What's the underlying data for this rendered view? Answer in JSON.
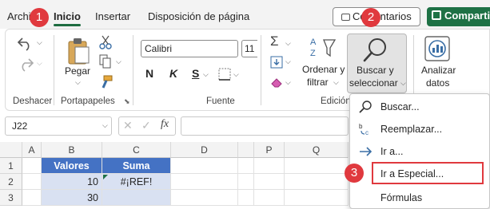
{
  "tabs": [
    {
      "label": "Archivo",
      "active": false
    },
    {
      "label": "Inicio",
      "active": true
    },
    {
      "label": "Insertar",
      "active": false
    },
    {
      "label": "Disposición de página",
      "active": false
    }
  ],
  "header_buttons": {
    "comments": "Comentarios",
    "share": "Compartir"
  },
  "ribbon": {
    "undo_group_label": "Deshacer",
    "clipboard": {
      "paste_label": "Pegar",
      "group_label": "Portapapeles"
    },
    "font": {
      "font_name": "Calibri",
      "font_size": "11",
      "bold": "N",
      "italic": "K",
      "underline": "S",
      "group_label": "Fuente"
    },
    "editing": {
      "autosum_symbol": "Σ",
      "sort_label": [
        "Ordenar y",
        "filtrar"
      ],
      "find_label": [
        "Buscar y",
        "seleccionar"
      ],
      "group_label": "Edición"
    },
    "analysis": {
      "analyze_label": [
        "Analizar",
        "datos"
      ]
    }
  },
  "formula_bar": {
    "name_box": "J22",
    "fx": "fx",
    "formula": ""
  },
  "columns": [
    "A",
    "B",
    "C",
    "D",
    "P",
    "Q"
  ],
  "rows": [
    "1",
    "2",
    "3"
  ],
  "table": {
    "headers": [
      "Valores",
      "Suma"
    ],
    "rows": [
      [
        "10",
        "#¡REF!"
      ],
      [
        "30",
        ""
      ]
    ]
  },
  "menu": {
    "items": [
      {
        "label": "Buscar...",
        "icon": "magnifier-icon",
        "highlighted": false
      },
      {
        "label": "Reemplazar...",
        "icon": "replace-icon",
        "highlighted": false
      },
      {
        "label": "Ir a...",
        "icon": "arrow-right-icon",
        "highlighted": false
      },
      {
        "label": "Ir a Especial...",
        "icon": "",
        "highlighted": true
      },
      {
        "label": "Fórmulas",
        "icon": "",
        "highlighted": false
      }
    ]
  },
  "steps": [
    "1",
    "2",
    "3"
  ],
  "colors": {
    "accent_green": "#1e6c41",
    "table_header": "#4472c4",
    "table_data": "#d9e1f2",
    "step_badge": "#e0393e"
  }
}
